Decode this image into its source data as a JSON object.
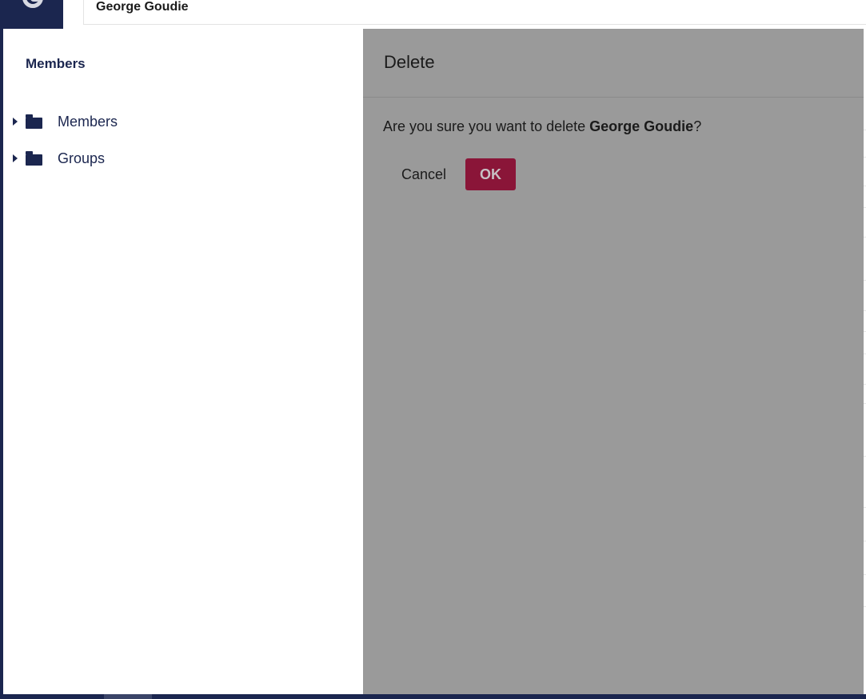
{
  "header": {
    "name_value": "George  Goudie"
  },
  "tree": {
    "title": "Members",
    "items": [
      {
        "label": "Members"
      },
      {
        "label": "Groups"
      }
    ]
  },
  "dialog": {
    "title": "Delete",
    "message_prefix": "Are you sure you want to delete ",
    "message_target": "George Goudie",
    "message_suffix": "?",
    "cancel_label": "Cancel",
    "ok_label": "OK"
  },
  "colors": {
    "brand_navy": "#1b264f",
    "ok_button": "#8a1538",
    "dialog_background": "#9a9a9a"
  },
  "icons": {
    "logo": "umbraco-logo-icon",
    "expand": "caret-right-icon",
    "folder": "folder-icon"
  }
}
